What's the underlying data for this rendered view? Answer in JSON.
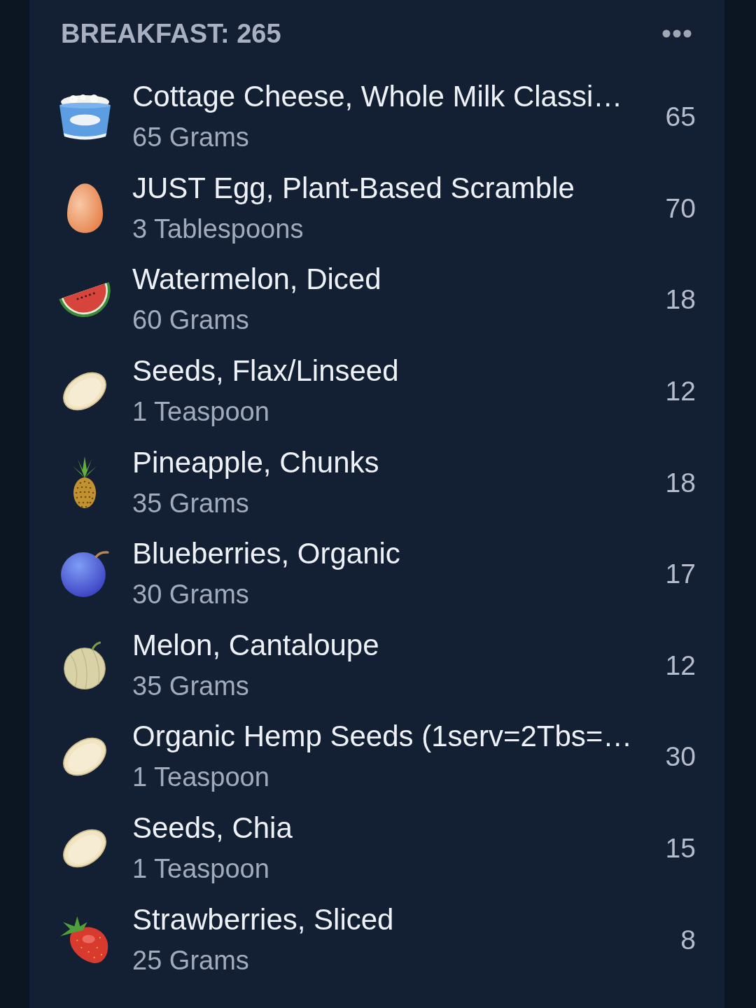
{
  "meal": {
    "title": "BREAKFAST: 265"
  },
  "items": [
    {
      "kind": "tub",
      "name": "Cottage Cheese, Whole Milk Classi…",
      "serving": "65 Grams",
      "calories": "65"
    },
    {
      "kind": "egg",
      "name": "JUST Egg, Plant-Based Scramble",
      "serving": "3 Tablespoons",
      "calories": "70"
    },
    {
      "kind": "watermelon",
      "name": "Watermelon, Diced",
      "serving": "60 Grams",
      "calories": "18"
    },
    {
      "kind": "seed",
      "name": "Seeds, Flax/Linseed",
      "serving": "1 Teaspoon",
      "calories": "12"
    },
    {
      "kind": "pineapple",
      "name": "Pineapple, Chunks",
      "serving": "35 Grams",
      "calories": "18"
    },
    {
      "kind": "blueberry",
      "name": "Blueberries, Organic",
      "serving": "30 Grams",
      "calories": "17"
    },
    {
      "kind": "melon",
      "name": "Melon, Cantaloupe",
      "serving": "35 Grams",
      "calories": "12"
    },
    {
      "kind": "seed",
      "name": "Organic Hemp Seeds (1serv=2Tbs=…",
      "serving": "1 Teaspoon",
      "calories": "30"
    },
    {
      "kind": "seed",
      "name": "Seeds, Chia",
      "serving": "1 Teaspoon",
      "calories": "15"
    },
    {
      "kind": "strawberry",
      "name": "Strawberries, Sliced",
      "serving": "25 Grams",
      "calories": "8"
    }
  ]
}
